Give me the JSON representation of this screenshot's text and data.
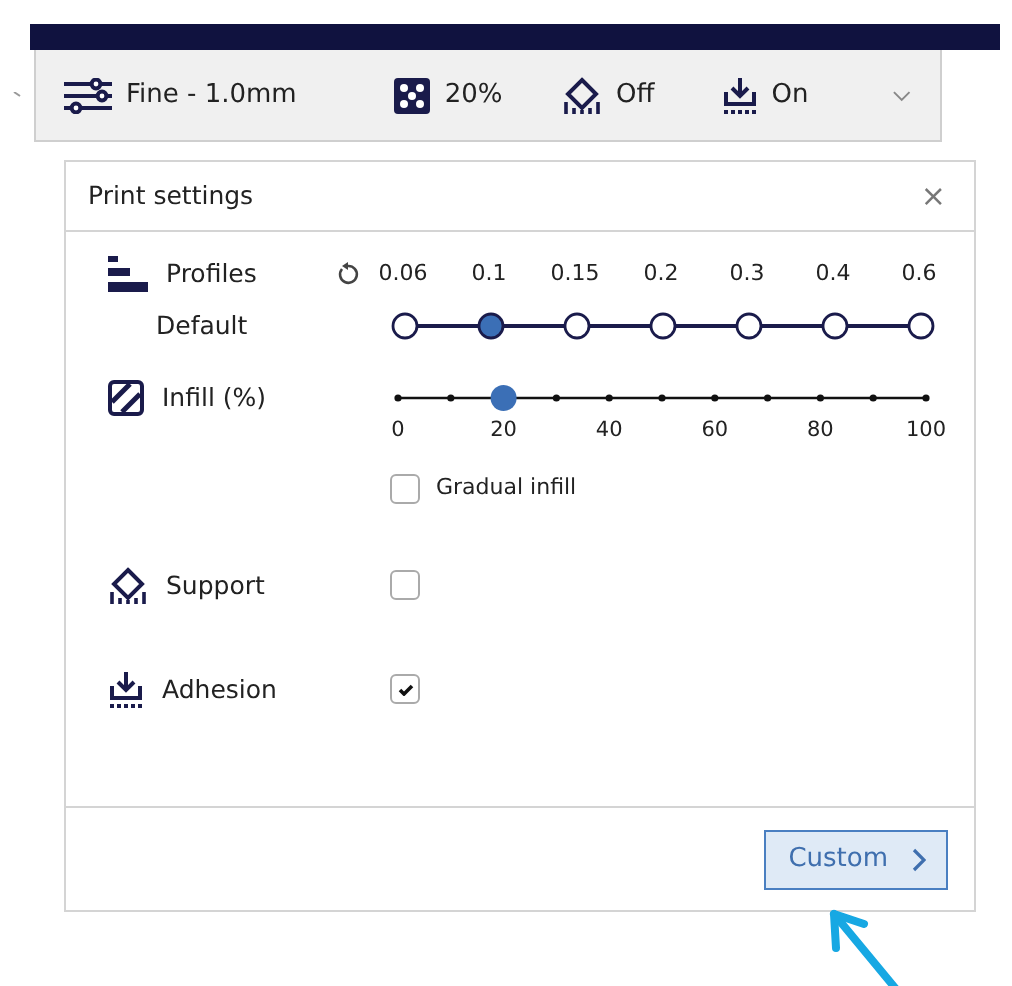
{
  "toolbar": {
    "profile": "Fine - 1.0mm",
    "infill": "20%",
    "support": "Off",
    "adhesion": "On"
  },
  "panel": {
    "title": "Print settings",
    "close": "×",
    "profiles": {
      "label": "Profiles",
      "sublabel": "Default",
      "stops": [
        {
          "label": "0.06",
          "selected": false
        },
        {
          "label": "0.1",
          "selected": true
        },
        {
          "label": "0.15",
          "selected": false
        },
        {
          "label": "0.2",
          "selected": false
        },
        {
          "label": "0.3",
          "selected": false
        },
        {
          "label": "0.4",
          "selected": false
        },
        {
          "label": "0.6",
          "selected": false
        }
      ]
    },
    "infill": {
      "label": "Infill (%)",
      "level": 0.2,
      "ticks": [
        "0",
        "20",
        "40",
        "60",
        "80",
        "100"
      ]
    },
    "gradual": {
      "label": "Gradual infill",
      "checked": false
    },
    "support": {
      "label": "Support",
      "checked": false
    },
    "adhesion": {
      "label": "Adhesion",
      "checked": true
    },
    "custom_button": {
      "label": "Custom"
    }
  }
}
